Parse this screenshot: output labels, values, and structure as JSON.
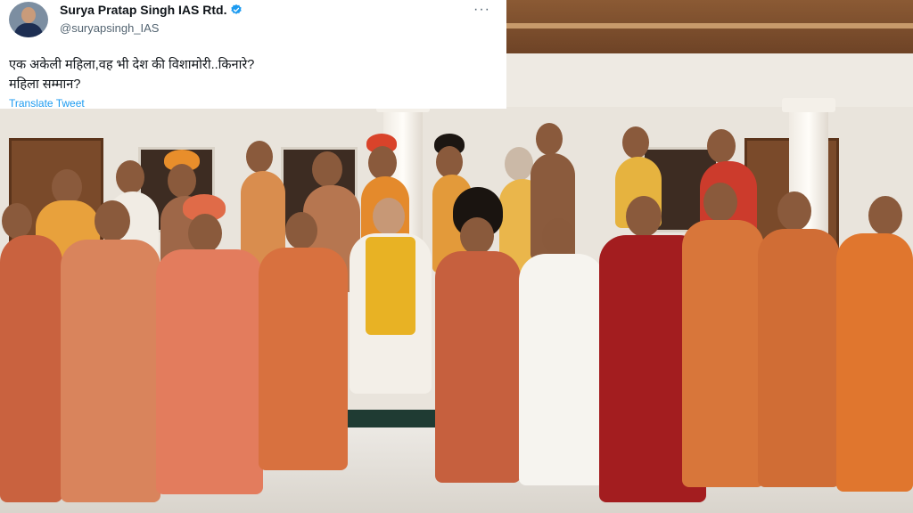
{
  "tweet": {
    "author_name": "Surya Pratap Singh IAS Rtd.",
    "author_handle": "@suryapsingh_IAS",
    "verified_icon": "verified-badge-icon",
    "more_icon": "more-horizontal-icon",
    "more_label": "···",
    "text_line1": "एक अकेली महिला,वह भी देश की विशामोरी..किनारे?",
    "text_line2": "महिला सम्मान?",
    "translate_label": "Translate Tweet",
    "accent_color": "#1d9bf0"
  }
}
